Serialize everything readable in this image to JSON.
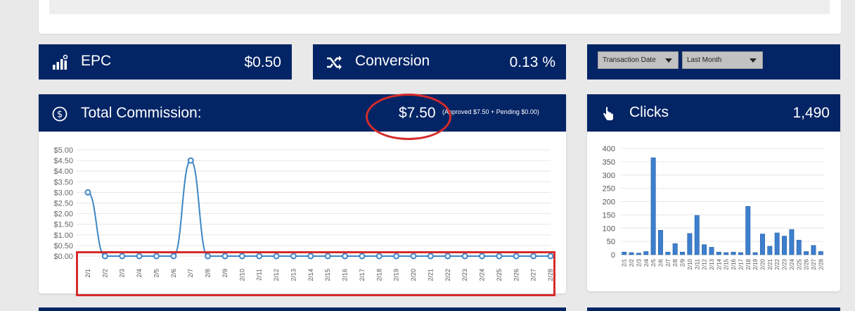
{
  "epc": {
    "title": "EPC",
    "value": "$0.50",
    "icon": "signal-bars-icon"
  },
  "conversion": {
    "title": "Conversion",
    "value": "0.13 %",
    "icon": "shuffle-icon"
  },
  "filters": {
    "date_type": "Transaction Date",
    "range": "Last Month"
  },
  "commission": {
    "title": "Total Commission:",
    "value": "$7.50",
    "note": "(Approved $7.50 + Pending $0.00)",
    "icon": "dollar-circle-icon"
  },
  "clicks": {
    "title": "Clicks",
    "value": "1,490",
    "icon": "pointer-hand-icon"
  },
  "colors": {
    "navy": "#032465",
    "line": "#3d86c6",
    "bar": "#3d7fcf",
    "annotation": "#d62b2b"
  },
  "chart_data": [
    {
      "type": "line",
      "x": [
        "2/1",
        "2/2",
        "2/3",
        "2/4",
        "2/5",
        "2/6",
        "2/7",
        "2/8",
        "2/9",
        "2/10",
        "2/11",
        "2/12",
        "2/13",
        "2/14",
        "2/15",
        "2/16",
        "2/17",
        "2/18",
        "2/19",
        "2/20",
        "2/21",
        "2/22",
        "2/23",
        "2/24",
        "2/25",
        "2/26",
        "2/27",
        "2/28"
      ],
      "values": [
        3.0,
        0,
        0,
        0,
        0,
        0,
        4.5,
        0,
        0,
        0,
        0,
        0,
        0,
        0,
        0,
        0,
        0,
        0,
        0,
        0,
        0,
        0,
        0,
        0,
        0,
        0,
        0,
        0
      ],
      "y_ticks": [
        "$5.00",
        "$4.50",
        "$4.00",
        "$3.50",
        "$3.00",
        "$2.50",
        "$2.00",
        "$1.50",
        "$1.00",
        "$0.50",
        "$0.00"
      ],
      "ylim": [
        0,
        5
      ],
      "grid": true
    },
    {
      "type": "bar",
      "categories": [
        "2/1",
        "2/2",
        "2/3",
        "2/4",
        "2/5",
        "2/6",
        "2/7",
        "2/8",
        "2/9",
        "2/10",
        "2/11",
        "2/12",
        "2/13",
        "2/14",
        "2/15",
        "2/16",
        "2/17",
        "2/18",
        "2/19",
        "2/20",
        "2/21",
        "2/22",
        "2/23",
        "2/24",
        "2/25",
        "2/26",
        "2/27",
        "2/28"
      ],
      "values": [
        10,
        8,
        6,
        12,
        365,
        92,
        10,
        42,
        10,
        80,
        148,
        38,
        28,
        10,
        8,
        10,
        8,
        182,
        8,
        78,
        32,
        82,
        70,
        95,
        55,
        12,
        35,
        12
      ],
      "y_ticks": [
        "400",
        "350",
        "300",
        "250",
        "200",
        "150",
        "100",
        "50",
        "0"
      ],
      "ylim": [
        0,
        400
      ],
      "grid": true
    }
  ]
}
